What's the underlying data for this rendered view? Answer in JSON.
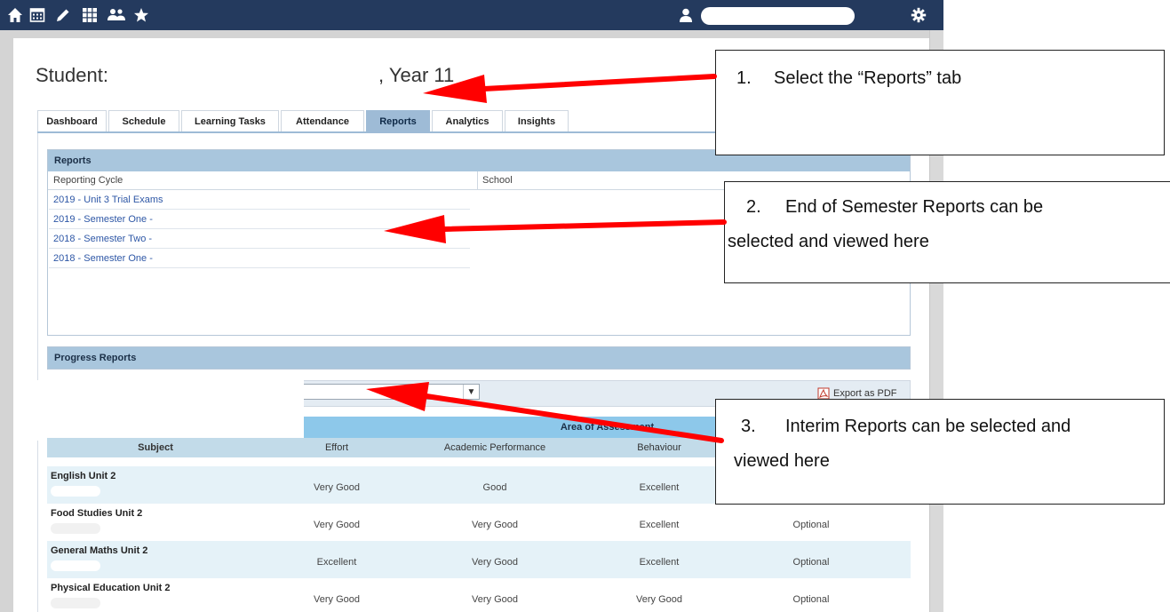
{
  "topbar": {
    "icons": [
      "home-icon",
      "calendar-icon",
      "pencil-icon",
      "grid-icon",
      "people-icon",
      "star-icon",
      "user-icon",
      "gear-icon"
    ]
  },
  "student": {
    "label": "Student:",
    "year": ", Year 11"
  },
  "tabs": [
    {
      "label": "Dashboard",
      "active": false
    },
    {
      "label": "Schedule",
      "active": false
    },
    {
      "label": "Learning Tasks",
      "active": false
    },
    {
      "label": "Attendance",
      "active": false
    },
    {
      "label": "Reports",
      "active": true
    },
    {
      "label": "Analytics",
      "active": false
    },
    {
      "label": "Insights",
      "active": false
    }
  ],
  "reports": {
    "title": "Reports",
    "columns": [
      "Reporting Cycle",
      "School"
    ],
    "rows": [
      "2019 - Unit 3 Trial Exams",
      "2019 - Semester One -",
      "2018 - Semester Two -",
      "2018 - Semester One -"
    ]
  },
  "progress": {
    "title": "Progress Reports",
    "export_label": "Export as PDF",
    "area_label": "Area of Assessment",
    "columns": [
      "Subject",
      "Effort",
      "Academic Performance",
      "Behaviour"
    ],
    "rows": [
      {
        "subject": "English Unit 2",
        "effort": "Very Good",
        "academic": "Good",
        "behaviour": "Excellent",
        "extra": ""
      },
      {
        "subject": "Food Studies Unit 2",
        "effort": "Very Good",
        "academic": "Very Good",
        "behaviour": "Excellent",
        "extra": "Optional"
      },
      {
        "subject": "General Maths Unit 2",
        "effort": "Excellent",
        "academic": "Very Good",
        "behaviour": "Excellent",
        "extra": "Optional"
      },
      {
        "subject": "Physical Education Unit 2",
        "effort": "Very Good",
        "academic": "Very Good",
        "behaviour": "Very Good",
        "extra": "Optional"
      }
    ]
  },
  "annotations": [
    {
      "number": "1.",
      "line1": "Select the “Reports” tab",
      "line2": ""
    },
    {
      "number": "2.",
      "line1": "End of Semester Reports can be",
      "line2": "selected and viewed here"
    },
    {
      "number": "3.",
      "line1": "Interim Reports can be selected and",
      "line2": "viewed here"
    }
  ],
  "colors": {
    "nav_bar": "#243a5e",
    "active_tab": "#9ebbd6",
    "panel_header": "#a9c6dd",
    "link": "#2e57a6",
    "arrow": "#ff0000"
  }
}
